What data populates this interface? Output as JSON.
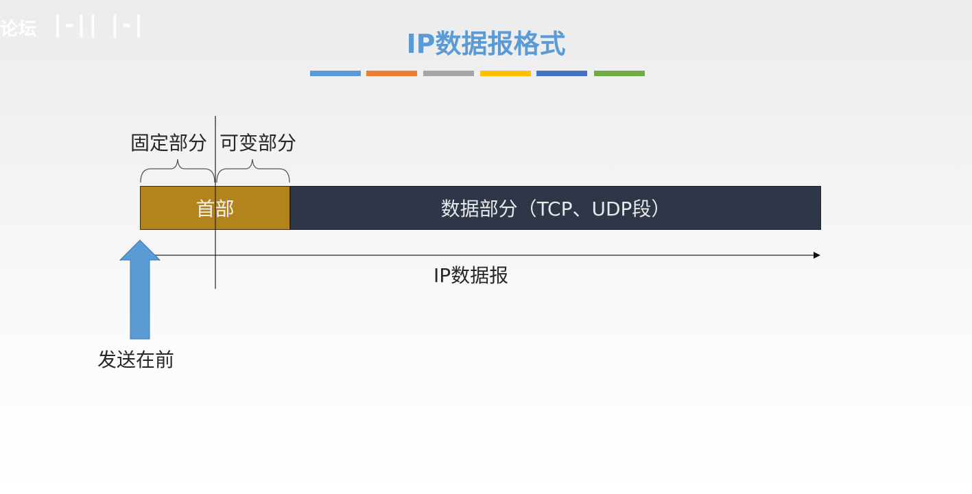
{
  "watermark": {
    "text": "论坛",
    "logo": "|-|| |-|"
  },
  "title": "IP数据报格式",
  "color_bars": [
    "#5b9bd5",
    "#ed7d31",
    "#a5a5a5",
    "#ffc000",
    "#4472c4",
    "#70ad47"
  ],
  "diagram": {
    "fixed_part_label": "固定部分",
    "variable_part_label": "可变部分",
    "header_label": "首部",
    "data_label": "数据部分（TCP、UDP段）",
    "datagram_label": "IP数据报",
    "send_first_label": "发送在前",
    "colors": {
      "header": "#b3841c",
      "data": "#2e3748",
      "arrow": "#5b9bd5"
    }
  }
}
